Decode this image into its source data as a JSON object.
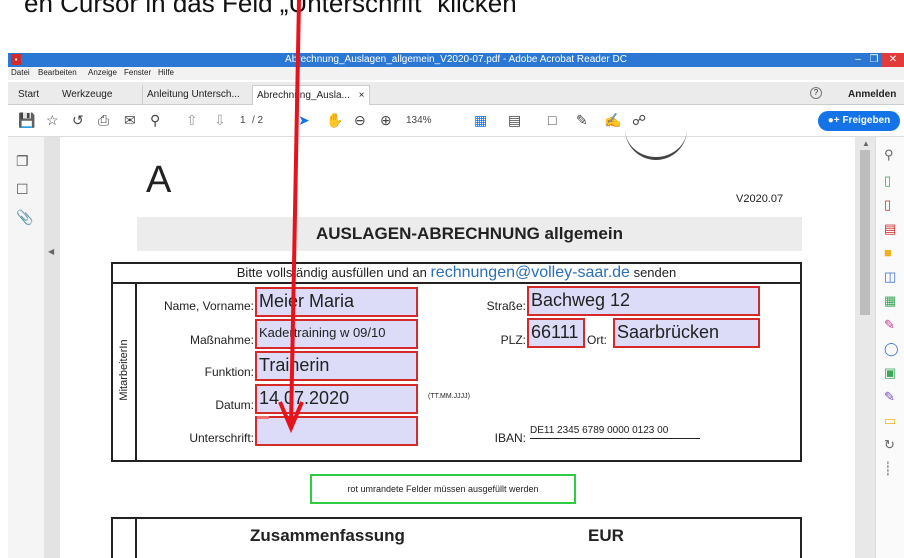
{
  "caption": "en Cursor in das Feld „Unterschrift“ klicken",
  "window": {
    "title": "Abrechnung_Auslagen_allgemein_V2020-07.pdf - Adobe Acrobat Reader DC",
    "app_icon": "pdf-icon"
  },
  "menu": [
    "Datei",
    "Bearbeiten",
    "Anzeige",
    "Fenster",
    "Hilfe"
  ],
  "tabs": {
    "start": "Start",
    "tools": "Werkzeuge",
    "doc1": "Anleitung Untersch...",
    "doc2": "Abrechnung_Ausla...",
    "close": "×",
    "help": "?",
    "signin": "Anmelden"
  },
  "toolbar": {
    "page_current": "1",
    "page_total": "/ 2",
    "zoom": "134%",
    "share": "Freigeben"
  },
  "doc": {
    "letter": "A",
    "version": "V2020.07",
    "heading": "AUSLAGEN-ABRECHNUNG allgemein",
    "instruction_prefix": "Bitte vollständig ausfüllen und an",
    "email": "rechnungen@volley-saar.de",
    "instruction_suffix": "senden",
    "side_label": "MitarbeiterIn",
    "name_label": "Name, Vorname:",
    "name_value": "Meier Maria",
    "street_label": "Straße:",
    "street_value": "Bachweg 12",
    "measure_label": "Maßnahme:",
    "measure_value": "Kadertraining w 09/10",
    "zip_label": "PLZ:",
    "zip_value": "66111",
    "city_label": "Ort:",
    "city_value": "Saarbrücken",
    "function_label": "Funktion:",
    "function_value": "Trainerin",
    "date_label": "Datum:",
    "date_value": "14.07.2020",
    "date_format": "(TT.MM.JJJJ)",
    "signature_label": "Unterschrift:",
    "iban_label": "IBAN:",
    "iban_value": "DE11 2345 6789 0000 0123 00",
    "required_note": "rot umrandete Felder müssen ausgefüllt werden",
    "summary_title": "Zusammenfassung",
    "summary_currency": "EUR"
  },
  "colors": {
    "titlebar": "#2b78d4",
    "accent": "#1473e6",
    "field_border": "#d42a2a",
    "field_fill": "#dcdcf8",
    "email": "#2a6fb8",
    "note_border": "#2ecc40"
  }
}
